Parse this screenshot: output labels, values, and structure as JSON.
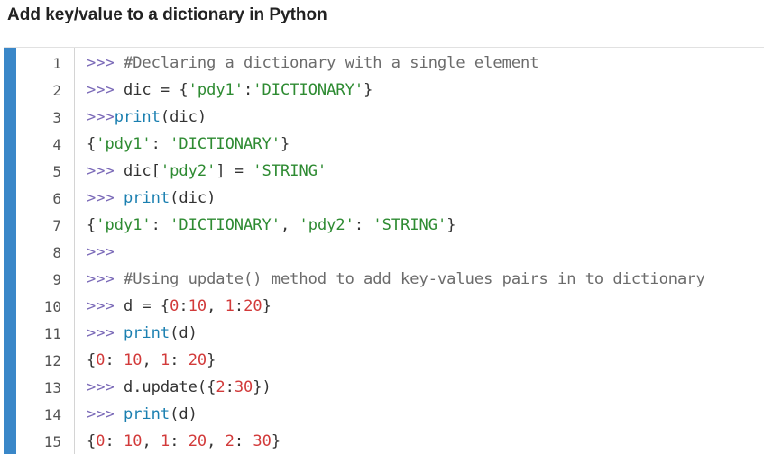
{
  "page": {
    "title": "Add key/value to a dictionary in Python"
  },
  "colors": {
    "accent_bar": "#3a87c8",
    "prompt": "#7b6ab8",
    "comment": "#6b6b6b",
    "string": "#2e8b32",
    "number": "#d23a3a",
    "function": "#1a7fb0",
    "text": "#333333"
  },
  "code": {
    "language": "python",
    "lines": [
      {
        "number": "1",
        "tokens": [
          {
            "text": ">>> ",
            "type": "prompt"
          },
          {
            "text": "#Declaring a dictionary with a single element",
            "type": "comment"
          }
        ]
      },
      {
        "number": "2",
        "tokens": [
          {
            "text": ">>> ",
            "type": "prompt"
          },
          {
            "text": "dic = {",
            "type": "name"
          },
          {
            "text": "'pdy1'",
            "type": "str"
          },
          {
            "text": ":",
            "type": "punc"
          },
          {
            "text": "'DICTIONARY'",
            "type": "str"
          },
          {
            "text": "}",
            "type": "punc"
          }
        ]
      },
      {
        "number": "3",
        "tokens": [
          {
            "text": ">>>",
            "type": "prompt"
          },
          {
            "text": "print",
            "type": "fn"
          },
          {
            "text": "(dic)",
            "type": "punc"
          }
        ]
      },
      {
        "number": "4",
        "tokens": [
          {
            "text": "{",
            "type": "punc"
          },
          {
            "text": "'pdy1'",
            "type": "str"
          },
          {
            "text": ": ",
            "type": "punc"
          },
          {
            "text": "'DICTIONARY'",
            "type": "str"
          },
          {
            "text": "}",
            "type": "punc"
          }
        ]
      },
      {
        "number": "5",
        "tokens": [
          {
            "text": ">>> ",
            "type": "prompt"
          },
          {
            "text": "dic[",
            "type": "name"
          },
          {
            "text": "'pdy2'",
            "type": "str"
          },
          {
            "text": "] = ",
            "type": "punc"
          },
          {
            "text": "'STRING'",
            "type": "str"
          }
        ]
      },
      {
        "number": "6",
        "tokens": [
          {
            "text": ">>> ",
            "type": "prompt"
          },
          {
            "text": "print",
            "type": "fn"
          },
          {
            "text": "(dic)",
            "type": "punc"
          }
        ]
      },
      {
        "number": "7",
        "tokens": [
          {
            "text": "{",
            "type": "punc"
          },
          {
            "text": "'pdy1'",
            "type": "str"
          },
          {
            "text": ": ",
            "type": "punc"
          },
          {
            "text": "'DICTIONARY'",
            "type": "str"
          },
          {
            "text": ", ",
            "type": "punc"
          },
          {
            "text": "'pdy2'",
            "type": "str"
          },
          {
            "text": ": ",
            "type": "punc"
          },
          {
            "text": "'STRING'",
            "type": "str"
          },
          {
            "text": "}",
            "type": "punc"
          }
        ]
      },
      {
        "number": "8",
        "tokens": [
          {
            "text": ">>>",
            "type": "prompt"
          }
        ]
      },
      {
        "number": "9",
        "tokens": [
          {
            "text": ">>> ",
            "type": "prompt"
          },
          {
            "text": "#Using update() method to add key-values pairs in to dictionary",
            "type": "comment"
          }
        ]
      },
      {
        "number": "10",
        "tokens": [
          {
            "text": ">>> ",
            "type": "prompt"
          },
          {
            "text": "d = {",
            "type": "name"
          },
          {
            "text": "0",
            "type": "num"
          },
          {
            "text": ":",
            "type": "punc"
          },
          {
            "text": "10",
            "type": "num"
          },
          {
            "text": ", ",
            "type": "punc"
          },
          {
            "text": "1",
            "type": "num"
          },
          {
            "text": ":",
            "type": "punc"
          },
          {
            "text": "20",
            "type": "num"
          },
          {
            "text": "}",
            "type": "punc"
          }
        ]
      },
      {
        "number": "11",
        "tokens": [
          {
            "text": ">>> ",
            "type": "prompt"
          },
          {
            "text": "print",
            "type": "fn"
          },
          {
            "text": "(d)",
            "type": "punc"
          }
        ]
      },
      {
        "number": "12",
        "tokens": [
          {
            "text": "{",
            "type": "punc"
          },
          {
            "text": "0",
            "type": "num"
          },
          {
            "text": ": ",
            "type": "punc"
          },
          {
            "text": "10",
            "type": "num"
          },
          {
            "text": ", ",
            "type": "punc"
          },
          {
            "text": "1",
            "type": "num"
          },
          {
            "text": ": ",
            "type": "punc"
          },
          {
            "text": "20",
            "type": "num"
          },
          {
            "text": "}",
            "type": "punc"
          }
        ]
      },
      {
        "number": "13",
        "tokens": [
          {
            "text": ">>> ",
            "type": "prompt"
          },
          {
            "text": "d.update({",
            "type": "name"
          },
          {
            "text": "2",
            "type": "num"
          },
          {
            "text": ":",
            "type": "punc"
          },
          {
            "text": "30",
            "type": "num"
          },
          {
            "text": "})",
            "type": "punc"
          }
        ]
      },
      {
        "number": "14",
        "tokens": [
          {
            "text": ">>> ",
            "type": "prompt"
          },
          {
            "text": "print",
            "type": "fn"
          },
          {
            "text": "(d)",
            "type": "punc"
          }
        ]
      },
      {
        "number": "15",
        "tokens": [
          {
            "text": "{",
            "type": "punc"
          },
          {
            "text": "0",
            "type": "num"
          },
          {
            "text": ": ",
            "type": "punc"
          },
          {
            "text": "10",
            "type": "num"
          },
          {
            "text": ", ",
            "type": "punc"
          },
          {
            "text": "1",
            "type": "num"
          },
          {
            "text": ": ",
            "type": "punc"
          },
          {
            "text": "20",
            "type": "num"
          },
          {
            "text": ", ",
            "type": "punc"
          },
          {
            "text": "2",
            "type": "num"
          },
          {
            "text": ": ",
            "type": "punc"
          },
          {
            "text": "30",
            "type": "num"
          },
          {
            "text": "}",
            "type": "punc"
          }
        ]
      }
    ]
  }
}
